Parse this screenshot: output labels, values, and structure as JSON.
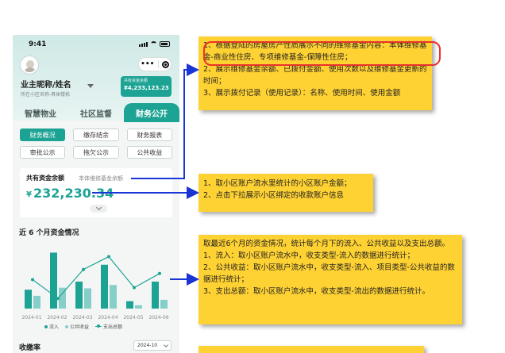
{
  "phone": {
    "status_time": "9:41",
    "user_name": "业主昵称/姓名",
    "user_sub": "所在小区名称-具体楼栋",
    "fund_badge": {
      "label": "共有资金余额",
      "value": "¥4,233,123.23"
    },
    "top_tabs": [
      {
        "label": "智慧物业",
        "active": false
      },
      {
        "label": "社区监督",
        "active": false
      },
      {
        "label": "财务公开",
        "active": true
      }
    ],
    "sub_tabs": [
      {
        "label": "财务概况",
        "active": true
      },
      {
        "label": "缴存结余",
        "active": false
      },
      {
        "label": "财务报表",
        "active": false
      },
      {
        "label": "审批公示",
        "active": false
      },
      {
        "label": "拖欠公示",
        "active": false
      },
      {
        "label": "公共收益",
        "active": false
      }
    ],
    "fund_card": {
      "label": "共有资金余额",
      "sub_label": "本体维修基金余额",
      "currency": "¥",
      "amount": "232,230.34"
    },
    "chart_title": "近 6 个月资金情况",
    "rate_title": "收缴率",
    "month_select": "2024-10"
  },
  "chart_data": {
    "type": "bar",
    "categories": [
      "2024-01",
      "2024-02",
      "2024-03",
      "2024-04",
      "2024-05",
      "2024-06"
    ],
    "series": [
      {
        "name": "流入",
        "type": "bar",
        "color": "#1da394",
        "values": [
          28,
          83,
          40,
          65,
          11,
          40
        ]
      },
      {
        "name": "公共收益",
        "type": "bar",
        "color": "#86cfc8",
        "values": [
          19,
          31,
          30,
          35,
          5,
          13
        ]
      },
      {
        "name": "支出总额",
        "type": "line",
        "color": "#1da394",
        "values": [
          43,
          15,
          58,
          77,
          31,
          52
        ]
      }
    ],
    "ylim": [
      0,
      100
    ],
    "legend": [
      "流入",
      "公共收益",
      "支出总额"
    ],
    "legend_position": "bottom"
  },
  "notes": {
    "note1": [
      "1、根据登陆的房屋房产性质展示不同的维修基金内容：本体维修基金-商业性住房、专项维修基金-保障性住房；",
      "2、展示维修基金余额、已拨付金额、使用次数以及维修基金更新的时间；",
      "3、展示拨付记录（使用记录）：名称、使用时间、使用金额"
    ],
    "note2": [
      "1、取小区账户流水里统计的小区账户金额；",
      "2、点击下拉展示小区绑定的收款账户信息"
    ],
    "note3": [
      "取最近6个月的资金情况，统计每个月下的流入、公共收益以及支出总额。",
      "1、流入：取小区账户流水中，收支类型-流入的数据进行统计；",
      "2、公共收益：取小区账户流水中，收支类型-流入、项目类型-公共收益的数据进行统计；",
      "3、支出总额：取小区账户流水中，收支类型-流出的数据进行统计。"
    ]
  },
  "colors": {
    "accent": "#1da394",
    "accent_light": "#86cfc8",
    "note_bg": "#ffd233",
    "arrow": "#1a35d6",
    "highlight": "#e8322a"
  }
}
